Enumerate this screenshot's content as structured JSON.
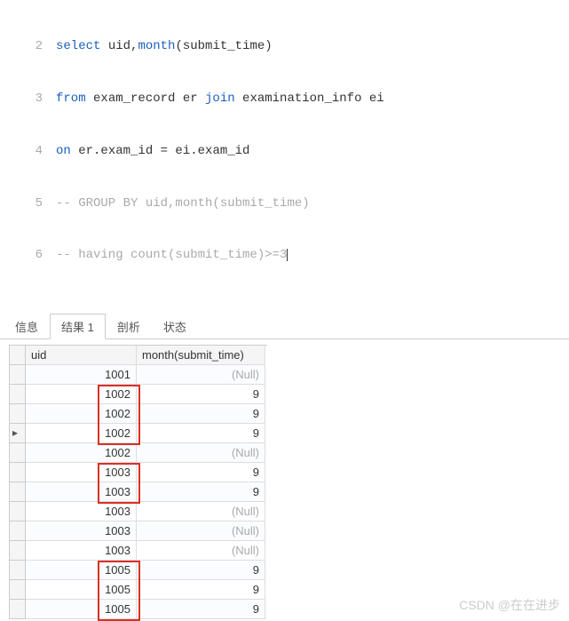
{
  "editor": {
    "lines": [
      {
        "n": "2",
        "plain": false
      },
      {
        "n": "3",
        "plain": false
      },
      {
        "n": "4",
        "plain": false
      },
      {
        "n": "5",
        "plain": false
      },
      {
        "n": "6",
        "plain": false
      }
    ],
    "line2_kw1": "select",
    "line2_t1": " uid,",
    "line2_kw2": "month",
    "line2_t2": "(submit_time)",
    "line3_kw1": "from",
    "line3_t1": " exam_record er ",
    "line3_kw2": "join",
    "line3_t2": " examination_info ei",
    "line4_kw1": "on",
    "line4_t1": " er.exam_id = ei.exam_id",
    "line5_c": "-- GROUP BY uid,month(submit_time)",
    "line6_c": "-- having count(submit_time)>=3"
  },
  "tabs": {
    "t0": "信息",
    "t1": "结果 1",
    "t2": "剖析",
    "t3": "状态"
  },
  "table": {
    "h1": "uid",
    "h2": "month(submit_time)",
    "rows": [
      {
        "uid": "1001",
        "m": "(Null)",
        "null": true
      },
      {
        "uid": "1002",
        "m": "9"
      },
      {
        "uid": "1002",
        "m": "9"
      },
      {
        "uid": "1002",
        "m": "9",
        "ptr": true
      },
      {
        "uid": "1002",
        "m": "(Null)",
        "null": true
      },
      {
        "uid": "1003",
        "m": "9"
      },
      {
        "uid": "1003",
        "m": "9"
      },
      {
        "uid": "1003",
        "m": "(Null)",
        "null": true
      },
      {
        "uid": "1003",
        "m": "(Null)",
        "null": true
      },
      {
        "uid": "1003",
        "m": "(Null)",
        "null": true
      },
      {
        "uid": "1005",
        "m": "9"
      },
      {
        "uid": "1005",
        "m": "9"
      },
      {
        "uid": "1005",
        "m": "9"
      }
    ]
  },
  "watermark": "CSDN @在在进步"
}
